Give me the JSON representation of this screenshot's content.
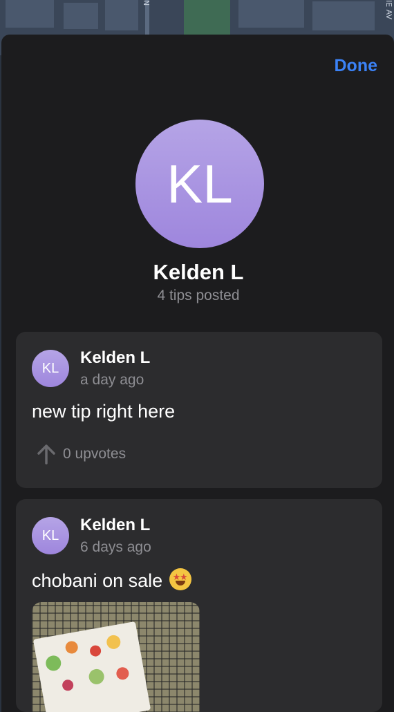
{
  "map": {
    "street_labels": [
      "N",
      "IE AV"
    ]
  },
  "header": {
    "done_label": "Done"
  },
  "profile": {
    "initials": "KL",
    "name": "Kelden L",
    "tips_posted": "4 tips posted"
  },
  "tips": [
    {
      "initials": "KL",
      "author": "Kelden L",
      "time": "a day ago",
      "text": "new tip right here",
      "upvotes_label": "0 upvotes"
    },
    {
      "initials": "KL",
      "author": "Kelden L",
      "time": "6 days ago",
      "text": "chobani on sale",
      "emoji": "star-struck-emoji",
      "has_photo": true
    }
  ],
  "colors": {
    "accent": "#3b82f6",
    "avatar": "#a591e0",
    "sheet": "#1c1c1e",
    "card": "#2c2c2e"
  }
}
